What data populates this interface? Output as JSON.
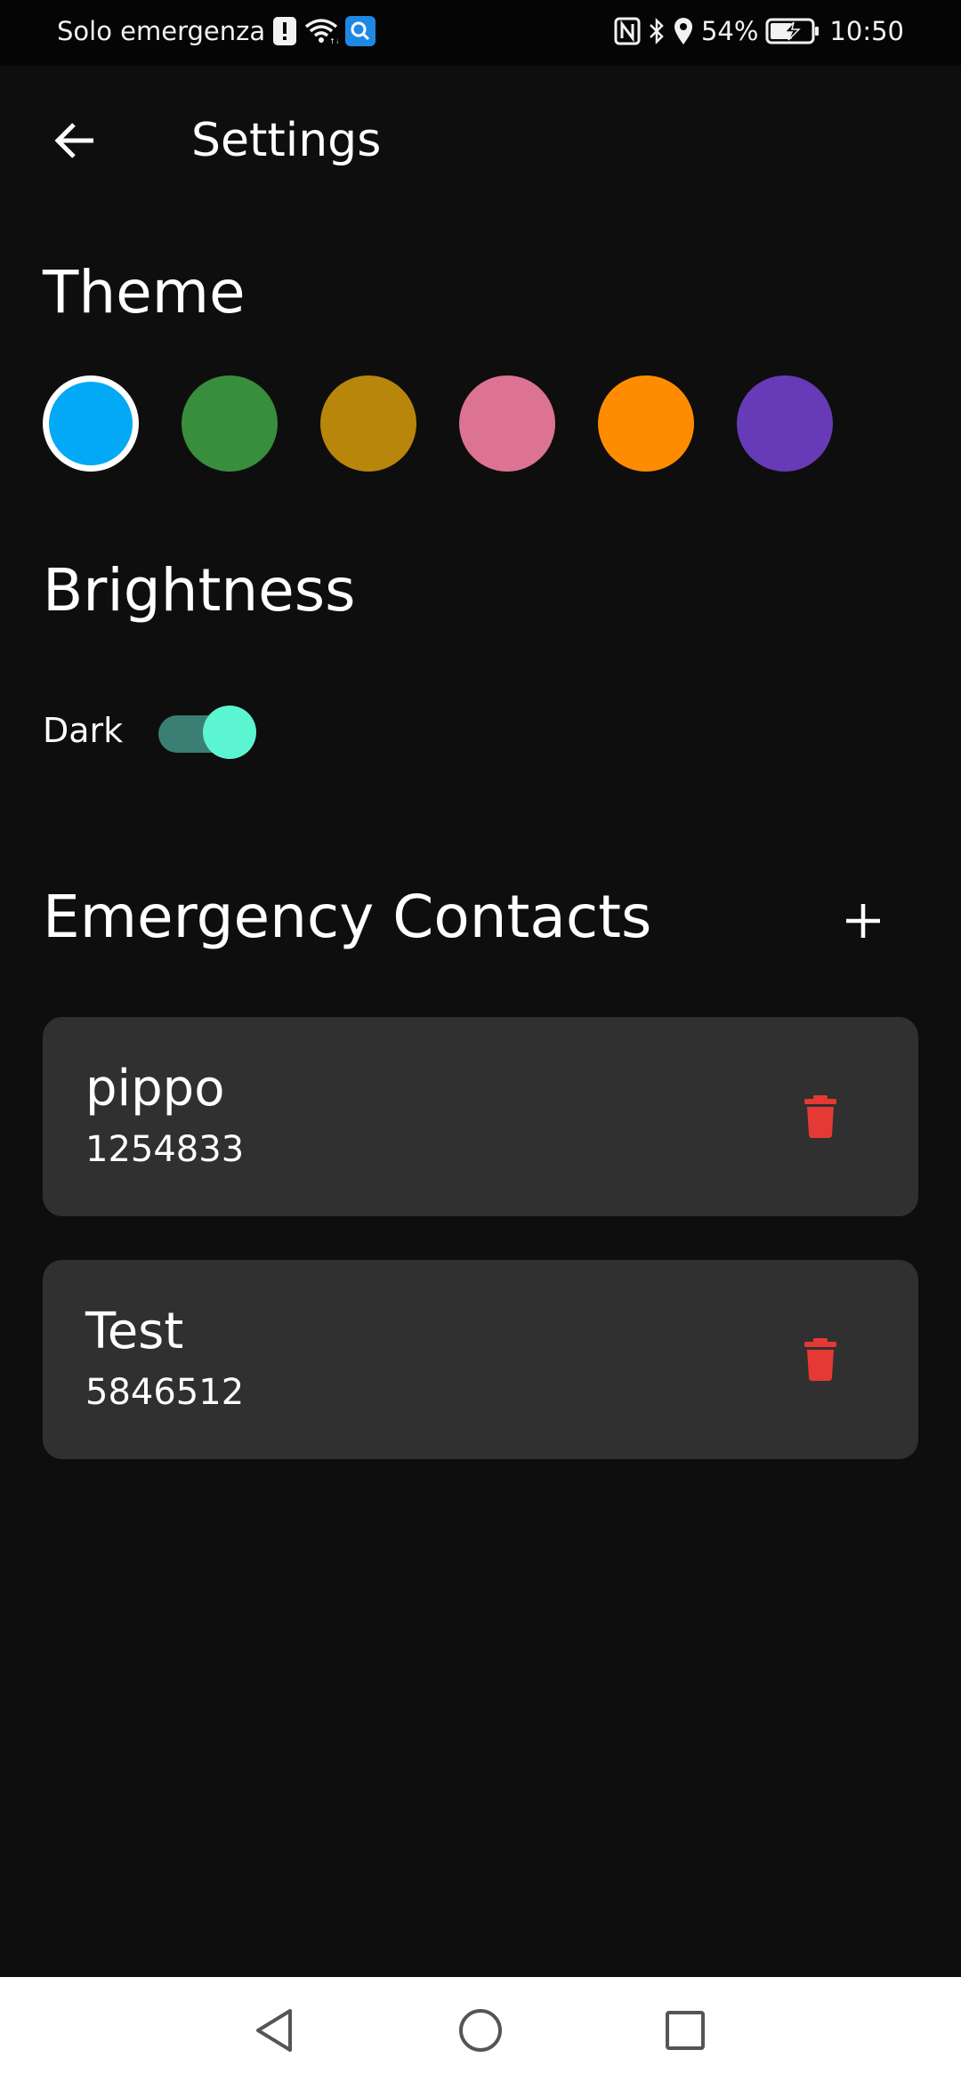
{
  "status_bar": {
    "carrier": "Solo emergenza",
    "battery": "54%",
    "time": "10:50",
    "icons": [
      "alert-icon",
      "wifi-icon",
      "search-app-icon",
      "nfc-icon",
      "bluetooth-icon",
      "location-icon",
      "battery-charging-icon"
    ]
  },
  "app_bar": {
    "title": "Settings",
    "back_icon": "arrow-left-icon"
  },
  "theme": {
    "title": "Theme",
    "colors": [
      "#03a9f4",
      "#388e3c",
      "#b8860b",
      "#dd7393",
      "#ff8c00",
      "#673ab7"
    ],
    "selected_index": 0
  },
  "brightness": {
    "title": "Brightness",
    "dark_label": "Dark",
    "dark_enabled": true
  },
  "emergency_contacts": {
    "title": "Emergency Contacts",
    "add_icon": "plus-icon",
    "contacts": [
      {
        "name": "pippo",
        "number": "1254833"
      },
      {
        "name": "Test",
        "number": "5846512"
      }
    ],
    "delete_icon": "trash-icon",
    "delete_color": "#e53935"
  },
  "nav_bar": {
    "buttons": [
      "back-triangle-icon",
      "home-circle-icon",
      "recents-square-icon"
    ]
  }
}
